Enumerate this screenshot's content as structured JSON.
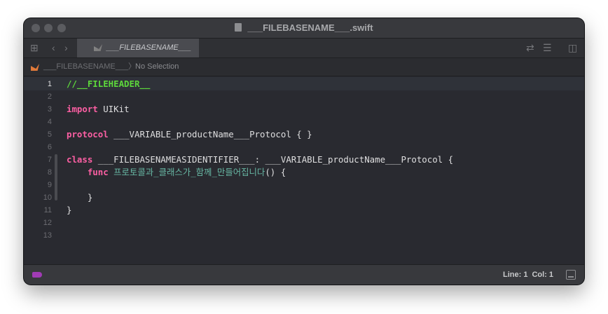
{
  "window": {
    "title": "___FILEBASENAME___.swift"
  },
  "tab": {
    "label": "___FILEBASENAME___"
  },
  "jumpbar": {
    "file": "___FILEBASENAME___",
    "selection": "No Selection"
  },
  "editor": {
    "current_line": 1,
    "lines": [
      {
        "n": "1",
        "parts": [
          {
            "t": "//__FILEHEADER__",
            "c": "cm"
          }
        ]
      },
      {
        "n": "2",
        "parts": []
      },
      {
        "n": "3",
        "parts": [
          {
            "t": "import",
            "c": "kw"
          },
          {
            "t": " UIKit",
            "c": "ty"
          }
        ]
      },
      {
        "n": "4",
        "parts": []
      },
      {
        "n": "5",
        "parts": [
          {
            "t": "protocol",
            "c": "kw"
          },
          {
            "t": " ___VARIABLE_productName___Protocol { }",
            "c": "ty"
          }
        ]
      },
      {
        "n": "6",
        "parts": []
      },
      {
        "n": "7",
        "parts": [
          {
            "t": "class",
            "c": "kw"
          },
          {
            "t": " ___FILEBASENAMEASIDENTIFIER___: ___VARIABLE_productName___Protocol {",
            "c": "ty"
          }
        ]
      },
      {
        "n": "8",
        "parts": [
          {
            "t": "    ",
            "c": "ty"
          },
          {
            "t": "func",
            "c": "kw"
          },
          {
            "t": " 프로토콜과_클래스가_함께_만들어집니다",
            "c": "fn"
          },
          {
            "t": "() {",
            "c": "ty"
          }
        ]
      },
      {
        "n": "9",
        "parts": []
      },
      {
        "n": "10",
        "parts": [
          {
            "t": "    }",
            "c": "ty"
          }
        ]
      },
      {
        "n": "11",
        "parts": [
          {
            "t": "}",
            "c": "ty"
          }
        ]
      },
      {
        "n": "12",
        "parts": []
      },
      {
        "n": "13",
        "parts": []
      }
    ]
  },
  "status": {
    "line": "Line: 1",
    "col": "Col: 1"
  },
  "icons": {
    "toolbar_grid": "grid-icon",
    "toolbar_back": "chevron-left-icon",
    "toolbar_forward": "chevron-right-icon",
    "tab_file": "swift-icon",
    "toolbar_related": "swap-icon",
    "toolbar_lines": "lines-icon",
    "toolbar_add_editor": "add-editor-icon"
  }
}
